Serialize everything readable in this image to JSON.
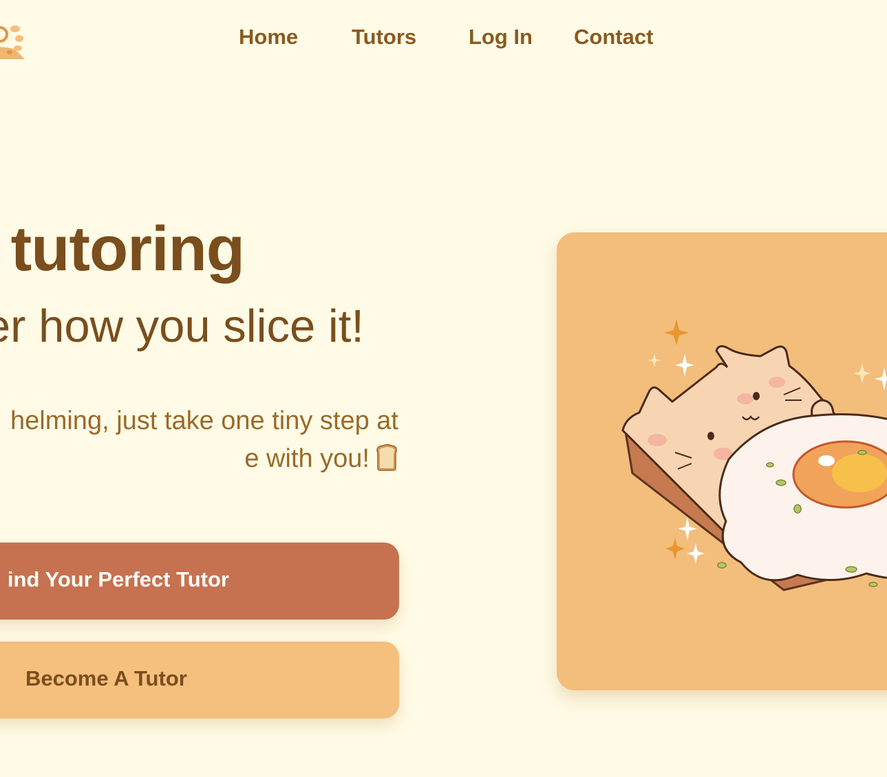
{
  "nav": {
    "home": "Home",
    "tutors": "Tutors",
    "login": "Log In",
    "contact": "Contact"
  },
  "hero": {
    "title": "tutoring",
    "subtitle": "er how you slice it!",
    "description_line1": "helming, just take one tiny step at",
    "description_line2": "e with you!"
  },
  "buttons": {
    "primary": "ind Your Perfect Tutor",
    "secondary": "Become A Tutor"
  },
  "illustration": {
    "subject": "cat-shaped toast with fried egg"
  },
  "colors": {
    "background": "#fffbe6",
    "nav_text": "#8b5a1f",
    "heading": "#7a4e1d",
    "body_text": "#9a6a2a",
    "primary_button": "#c67250",
    "secondary_button": "#f5bf7d",
    "card": "#f3bd7c"
  }
}
